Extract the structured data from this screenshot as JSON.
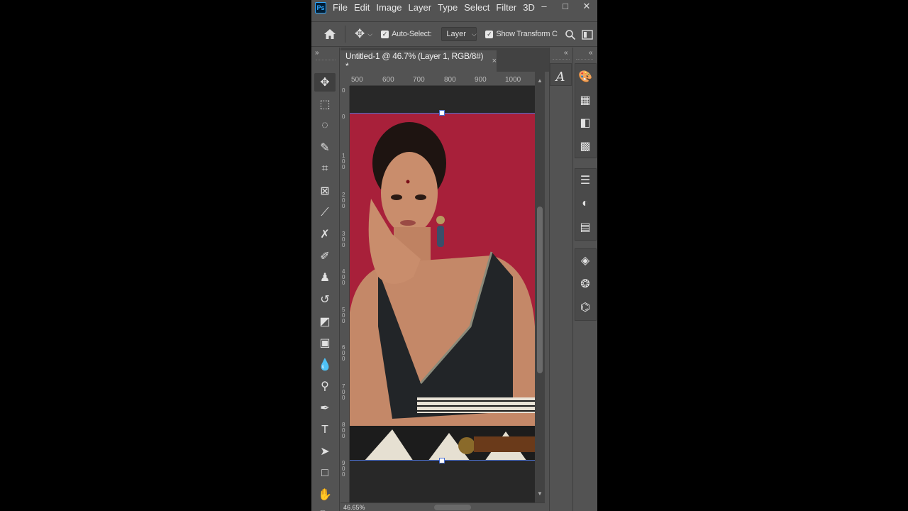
{
  "app": {
    "logo": "Ps",
    "menu": [
      "File",
      "Edit",
      "Image",
      "Layer",
      "Type",
      "Select",
      "Filter",
      "3D"
    ],
    "window_controls": [
      "–",
      "□",
      "✕"
    ]
  },
  "options_bar": {
    "home_icon": "home-icon",
    "move_icon": "move-icon",
    "auto_select_checked": "✓",
    "auto_select_label": "Auto-Select:",
    "layer_select_value": "Layer",
    "show_transform_checked": "✓",
    "show_transform_label": "Show Transform C",
    "tail_icons": [
      "search-icon",
      "frame-icon"
    ]
  },
  "document": {
    "tab_title": "Untitled-1 @ 46.7% (Layer 1, RGB/8#) *",
    "tab_close": "×"
  },
  "rulers": {
    "top": [
      "500",
      "600",
      "700",
      "800",
      "900",
      "1000"
    ],
    "left": [
      "0",
      "0",
      "100",
      "200",
      "300",
      "400",
      "500",
      "600",
      "700",
      "800",
      "900"
    ]
  },
  "status": {
    "zoom": "46.65%"
  },
  "toolbar": {
    "collapse": "»",
    "tools": [
      {
        "name": "move-tool",
        "glyph": "✥",
        "active": true
      },
      {
        "name": "marquee-tool",
        "glyph": "⬚"
      },
      {
        "name": "lasso-tool",
        "glyph": "◌"
      },
      {
        "name": "quick-selection-tool",
        "glyph": "✎"
      },
      {
        "name": "crop-tool",
        "glyph": "⌗"
      },
      {
        "name": "frame-tool",
        "glyph": "⊠"
      },
      {
        "name": "eyedropper-tool",
        "glyph": "⟋"
      },
      {
        "name": "healing-tool",
        "glyph": "✗"
      },
      {
        "name": "brush-tool",
        "glyph": "✐"
      },
      {
        "name": "stamp-tool",
        "glyph": "♟"
      },
      {
        "name": "history-brush-tool",
        "glyph": "↺"
      },
      {
        "name": "eraser-tool",
        "glyph": "◩"
      },
      {
        "name": "gradient-tool",
        "glyph": "▣"
      },
      {
        "name": "blur-tool",
        "glyph": "💧"
      },
      {
        "name": "dodge-tool",
        "glyph": "⚲"
      },
      {
        "name": "pen-tool",
        "glyph": "✒"
      },
      {
        "name": "type-tool",
        "glyph": "T"
      },
      {
        "name": "path-selection-tool",
        "glyph": "➤"
      },
      {
        "name": "rectangle-tool",
        "glyph": "□"
      },
      {
        "name": "hand-tool",
        "glyph": "✋"
      },
      {
        "name": "zoom-tool",
        "glyph": "🔍"
      }
    ]
  },
  "panels": {
    "col1_chevron": "«",
    "col2_chevron": "«",
    "col1_icons": [
      {
        "name": "character-panel-icon",
        "glyph": "A"
      }
    ],
    "col2_group1": [
      {
        "name": "color-panel-icon",
        "glyph": "🎨"
      },
      {
        "name": "swatches-panel-icon",
        "glyph": "▦"
      },
      {
        "name": "gradients-panel-icon",
        "glyph": "◧"
      },
      {
        "name": "patterns-panel-icon",
        "glyph": "▩"
      }
    ],
    "col2_group2": [
      {
        "name": "properties-panel-icon",
        "glyph": "☰"
      },
      {
        "name": "adjustments-panel-icon",
        "glyph": "◐"
      },
      {
        "name": "libraries-panel-icon",
        "glyph": "▤"
      }
    ],
    "col2_group3": [
      {
        "name": "layers-panel-icon",
        "glyph": "◈"
      },
      {
        "name": "channels-panel-icon",
        "glyph": "❂"
      },
      {
        "name": "paths-panel-icon",
        "glyph": "⌬"
      }
    ]
  },
  "colors": {
    "artwork_background": "#a8203a",
    "pasteboard": "#282828",
    "ui_panel": "#535353",
    "transform_border": "#4a6fd0"
  }
}
